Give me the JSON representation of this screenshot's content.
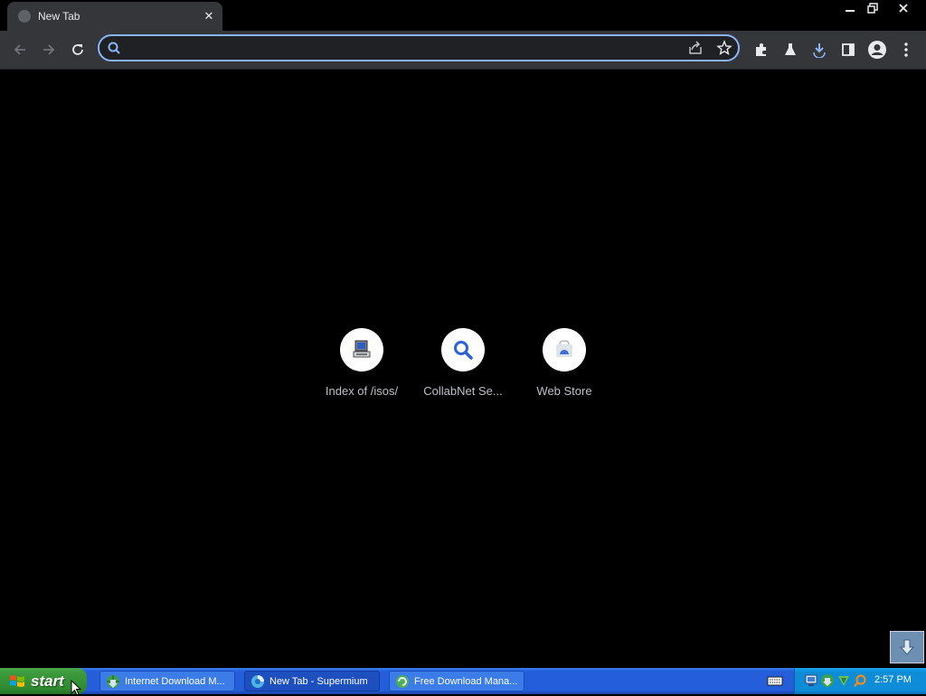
{
  "browser": {
    "tab": {
      "title": "New Tab"
    },
    "omnibox": {
      "value": "",
      "placeholder": ""
    },
    "accent_color": "#8ab4f8"
  },
  "shortcuts": [
    {
      "label": "Index of /isos/",
      "icon": "computer-icon"
    },
    {
      "label": "CollabNet Se...",
      "icon": "magnifier-icon"
    },
    {
      "label": "Web Store",
      "icon": "web-store-icon"
    }
  ],
  "taskbar": {
    "start_label": "start",
    "buttons": [
      {
        "label": "Internet Download M...",
        "icon": "idm-globe-icon"
      },
      {
        "label": "New Tab - Supermium",
        "icon": "supermium-icon",
        "active": true
      },
      {
        "label": "Free Download Mana...",
        "icon": "fdm-icon"
      }
    ],
    "clock": "2:57 PM",
    "colors": {
      "bar": "#245edb",
      "start": "#3c9a3c",
      "tray": "#0f8cd8"
    }
  }
}
